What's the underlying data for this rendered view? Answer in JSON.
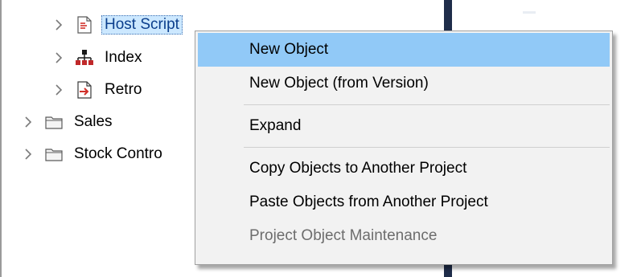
{
  "tree": {
    "items": [
      {
        "label": "Host Script",
        "icon": "script-page-icon",
        "selected": true
      },
      {
        "label": "Index",
        "icon": "index-hierarchy-icon",
        "selected": false
      },
      {
        "label": "Retro",
        "icon": "retro-arrow-icon",
        "selected": false
      },
      {
        "label": "Sales",
        "icon": "folder-icon",
        "selected": false
      },
      {
        "label": "Stock Contro",
        "icon": "folder-icon",
        "selected": false
      }
    ]
  },
  "context_menu": {
    "items": [
      {
        "label": "New Object",
        "state": "highlighted"
      },
      {
        "label": "New Object (from Version)",
        "state": "normal"
      },
      {
        "label": "Expand",
        "state": "normal"
      },
      {
        "label": "Copy Objects to Another Project",
        "state": "normal"
      },
      {
        "label": "Paste Objects from Another Project",
        "state": "normal"
      },
      {
        "label": "Project Object Maintenance",
        "state": "disabled"
      }
    ]
  },
  "colors": {
    "menu_highlight": "#91c9f7",
    "selection_bg": "#cce8ff",
    "divider_bar": "#1f2d4a",
    "disabled_text": "#6d6d6d"
  }
}
